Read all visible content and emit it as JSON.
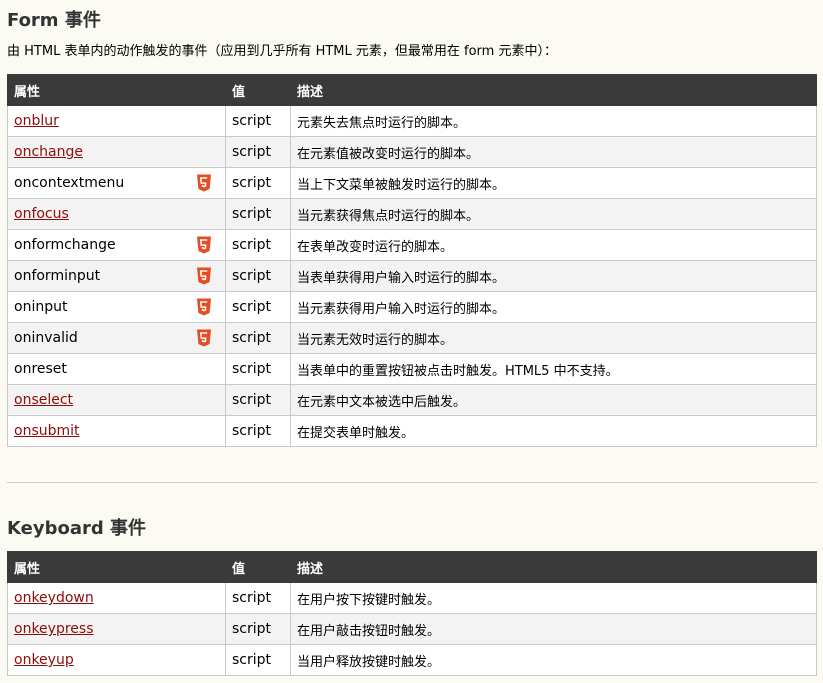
{
  "form_section": {
    "title": "Form 事件",
    "intro": "由 HTML 表单内的动作触发的事件（应用到几乎所有 HTML 元素，但最常用在 form 元素中）：",
    "headers": {
      "attr": "属性",
      "value": "值",
      "desc": "描述"
    },
    "rows": [
      {
        "attr": "onblur",
        "link": true,
        "html5": false,
        "value": "script",
        "desc": "元素失去焦点时运行的脚本。"
      },
      {
        "attr": "onchange",
        "link": true,
        "html5": false,
        "value": "script",
        "desc": "在元素值被改变时运行的脚本。"
      },
      {
        "attr": "oncontextmenu",
        "link": false,
        "html5": true,
        "value": "script",
        "desc": "当上下文菜单被触发时运行的脚本。"
      },
      {
        "attr": "onfocus",
        "link": true,
        "html5": false,
        "value": "script",
        "desc": "当元素获得焦点时运行的脚本。"
      },
      {
        "attr": "onformchange",
        "link": false,
        "html5": true,
        "value": "script",
        "desc": "在表单改变时运行的脚本。"
      },
      {
        "attr": "onforminput",
        "link": false,
        "html5": true,
        "value": "script",
        "desc": "当表单获得用户输入时运行的脚本。"
      },
      {
        "attr": "oninput",
        "link": false,
        "html5": true,
        "value": "script",
        "desc": "当元素获得用户输入时运行的脚本。"
      },
      {
        "attr": "oninvalid",
        "link": false,
        "html5": true,
        "value": "script",
        "desc": "当元素无效时运行的脚本。"
      },
      {
        "attr": "onreset",
        "link": false,
        "html5": false,
        "value": "script",
        "desc": "当表单中的重置按钮被点击时触发。HTML5 中不支持。"
      },
      {
        "attr": "onselect",
        "link": true,
        "html5": false,
        "value": "script",
        "desc": "在元素中文本被选中后触发。"
      },
      {
        "attr": "onsubmit",
        "link": true,
        "html5": false,
        "value": "script",
        "desc": "在提交表单时触发。"
      }
    ]
  },
  "keyboard_section": {
    "title": "Keyboard 事件",
    "headers": {
      "attr": "属性",
      "value": "值",
      "desc": "描述"
    },
    "rows": [
      {
        "attr": "onkeydown",
        "link": true,
        "html5": false,
        "value": "script",
        "desc": "在用户按下按键时触发。"
      },
      {
        "attr": "onkeypress",
        "link": true,
        "html5": false,
        "value": "script",
        "desc": "在用户敲击按钮时触发。"
      },
      {
        "attr": "onkeyup",
        "link": true,
        "html5": false,
        "value": "script",
        "desc": "当用户释放按键时触发。"
      }
    ]
  },
  "colors": {
    "link": "#900b09",
    "header_bg": "#3a3a3a",
    "html5_badge": "#e44d26"
  },
  "icons": {
    "html5_badge": "html5-icon"
  }
}
